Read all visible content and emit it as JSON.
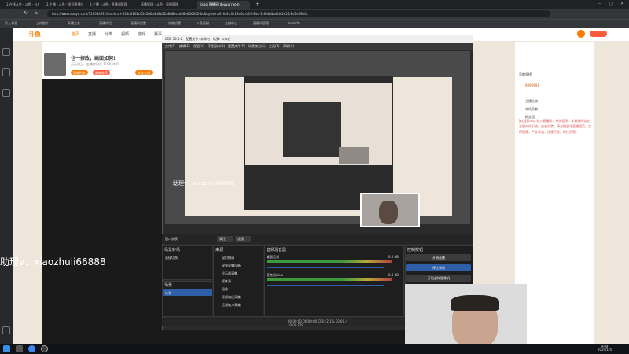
{
  "browser": {
    "tabs": [
      {
        "label": "1.在线斗鱼 - 斗鱼 - 斗鱼",
        "active": false
      },
      {
        "label": "2.主播 - 斗鱼 - 发现直播与",
        "active": false
      },
      {
        "label": "3.主播 - 斗鱼 - 直播间管理",
        "active": false
      },
      {
        "label": "直播管理 - 斗鱼 - 直播管理",
        "active": false
      },
      {
        "label": "jiang_直播间_douyu_room",
        "active": true
      }
    ],
    "url": "http://www.douyu.com/71903491?dyshid=0-854d0102c6545d0a4d6b52a8d8ecsde8e000000-2c&dyshci=0-5b4=0c18e6c2a14-8bc-1c60b4ba0de2c51/8d1ef-8e4c",
    "bookmarks": [
      "导入书签",
      "上传图片",
      "开播工具",
      "直播伴侣",
      "直播间设置",
      "礼物设置",
      "斗鱼直播",
      "主播中心",
      "直播间管理",
      "Geekdir"
    ]
  },
  "douyu": {
    "logo": "斗鱼",
    "nav": [
      "首页",
      "直播",
      "分类",
      "视频",
      "游戏",
      "赛事"
    ],
    "room_title": "也一修改，画面如何!",
    "room_sub": "天天向上 · 主播房间号 71903491",
    "tags": [
      "直播时长",
      "最新推荐",
      "关注主播"
    ],
    "right_panel": {
      "rank_label": "贡献周榜",
      "id_badge": "9890991",
      "items": [
        "主播礼物",
        "本场贡献",
        "粉丝团"
      ],
      "danmu": "[欢迎]Jiang 进入直播间，系统提示：本直播间禁止主播内外引流，违者封禁。请主播遵守直播规范，文明直播，严禁导流、违规打赏，理性消费。"
    },
    "side_icons": [
      "home-icon",
      "follow-icon",
      "history-icon",
      "settings-icon"
    ]
  },
  "obs": {
    "title": "OBS 30.0.2 - 配置文件: 未命名 - 场景: 未命名",
    "menu": [
      "文件(F)",
      "编辑(E)",
      "视图(V)",
      "停靠窗口(D)",
      "配置文件(P)",
      "场景集合(S)",
      "工具(T)",
      "帮助(H)"
    ],
    "watermark_preview": "助理v：xiaozhuli66888",
    "scene_bar": "窗口捕获",
    "scene_bar_buttons": [
      "属性",
      "滤镜"
    ],
    "panels": {
      "scenes": {
        "title": "场景转场",
        "items": [
          "直接切换"
        ]
      },
      "sources_left": {
        "title": "场景",
        "items": [
          "场景"
        ]
      },
      "sources": {
        "title": "来源",
        "items": [
          "窗口捕获",
          "视频采集设备",
          "显示器采集",
          "媒体源",
          "图像",
          "音频输出采集",
          "音频输入采集"
        ]
      },
      "mixer": {
        "title": "音频混音器",
        "tracks": [
          {
            "name": "桌面音频",
            "db": "0.0 dB"
          },
          {
            "name": "麦克风/Aux",
            "db": "0.0 dB"
          }
        ]
      },
      "controls": {
        "title": "控制按钮",
        "buttons": [
          "开始直播",
          "停止录制",
          "开始虚拟摄像机",
          "工作室模式"
        ]
      }
    },
    "status": "00:00:00  00:00:00  CPU: 2.1%  30.00 / 30.00 FPS"
  },
  "overlay": {
    "text": "助理v：xiaozhuli66888"
  },
  "taskbar": {
    "time": "9:04",
    "date": "2024/1/4",
    "apps": [
      "start-icon",
      "search-icon",
      "chrome-icon",
      "obs-icon"
    ]
  },
  "colors": {
    "douyu_accent": "#ff7a00",
    "obs_primary": "#2f5ea8",
    "danmu": "#d9534f"
  }
}
